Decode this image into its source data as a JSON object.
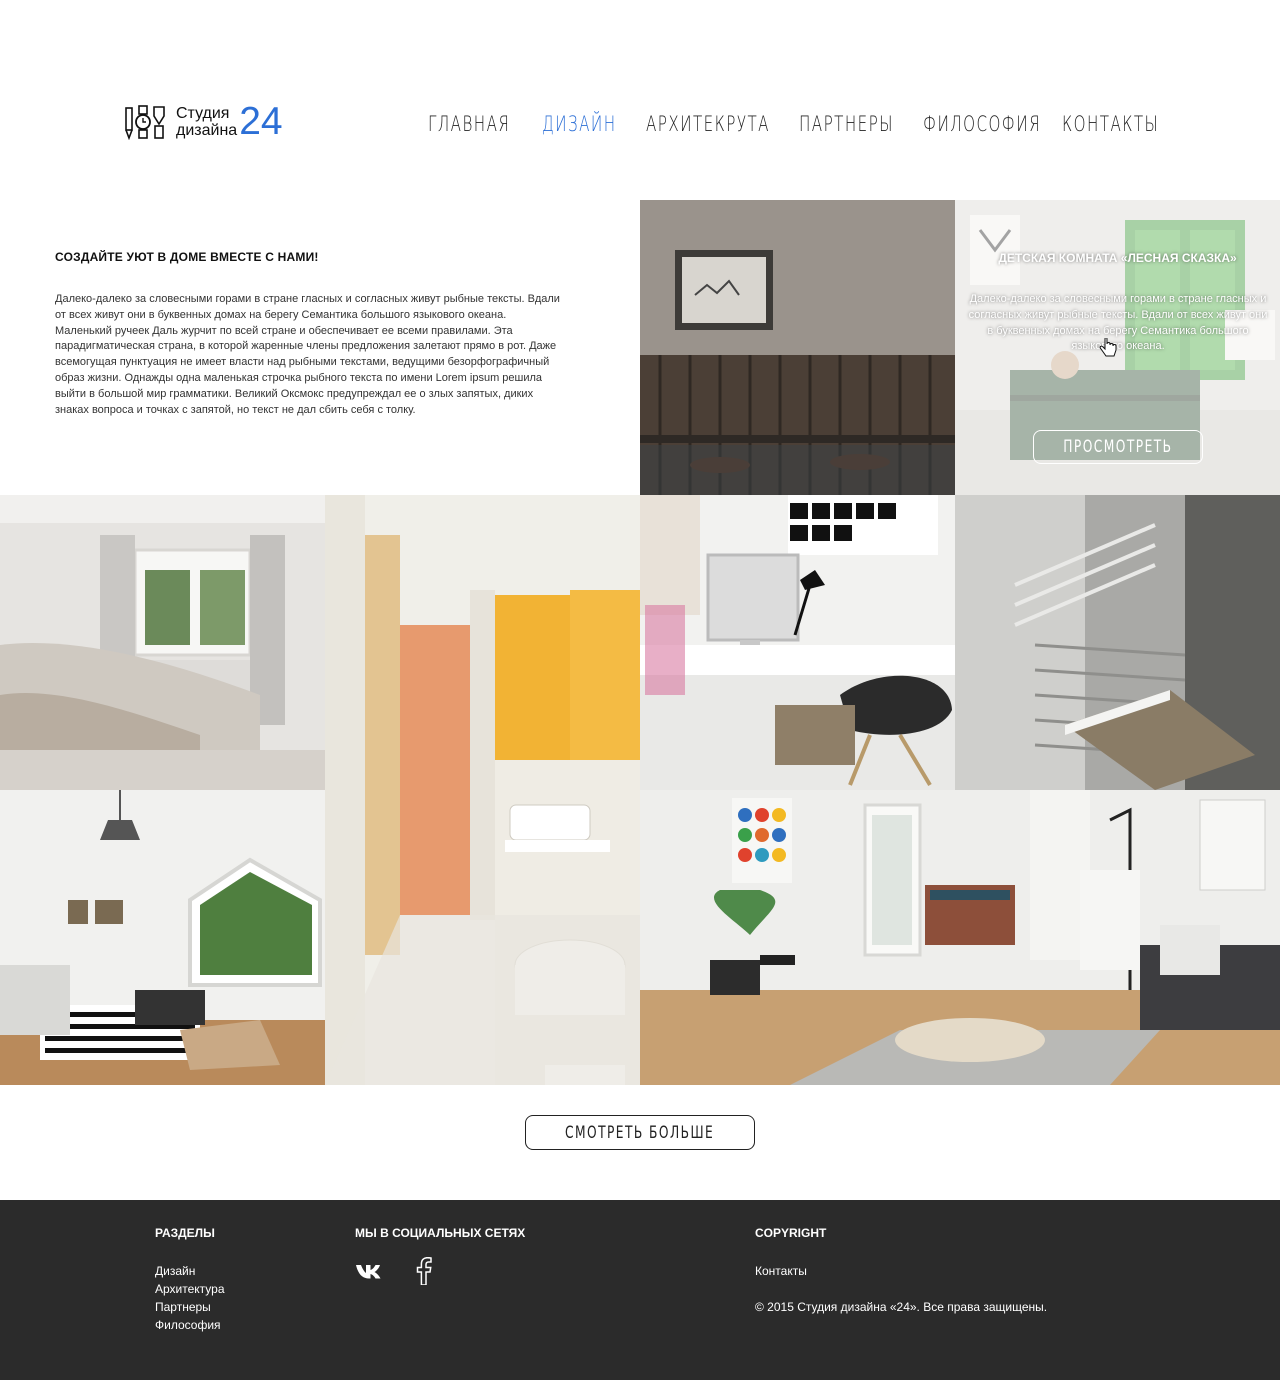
{
  "brand": {
    "line1": "Студия",
    "line2": "дизайна",
    "number": "24",
    "accent_color": "#2c6fd6"
  },
  "nav": {
    "items": [
      {
        "label": "Главная",
        "active": false
      },
      {
        "label": "Дизайн",
        "active": true
      },
      {
        "label": "Архитекрута",
        "active": false
      },
      {
        "label": "Партнеры",
        "active": false
      },
      {
        "label": "Философия",
        "active": false
      },
      {
        "label": "Контакты",
        "active": false
      }
    ]
  },
  "intro": {
    "title": "СОЗДАЙТЕ УЮТ В ДОМЕ ВМЕСТЕ С НАМИ!",
    "text": "Далеко-далеко за словесными горами в стране гласных и согласных живут рыбные тексты. Вдали от всех живут они в буквенных домах на берегу Семантика большого языкового океана. Маленький ручеек Даль журчит по всей стране и обеспечивает ее всеми правилами. Эта парадигматическая страна, в которой жаренные члены предложения залетают прямо в рот. Даже всемогущая пунктуация не имеет власти над рыбными текстами, ведущими безорфографичный образ жизни. Однажды одна маленькая строчка рыбного текста по имени Lorem ipsum решила выйти в большой мир грамматики. Великий Оксмокс предупреждал ее о злых запятых, диких знаках вопроса и точках с запятой, но текст не дал сбить себя с толку."
  },
  "featured": {
    "title": "ДЕТСКАЯ КОМНАТА «ЛЕСНАЯ СКАЗКА»",
    "text": "Далеко-далеко за словесными горами в стране гласных и согласных живут рыбные тексты. Вдали от всех живут они в буквенных домах на берегу Семантика большого языкового океана.",
    "button_label": "Просмотреть"
  },
  "more_button_label": "Смотреть больше",
  "footer": {
    "sections_title": "РАЗДЕЛЫ",
    "sections_links": [
      "Дизайн",
      "Архитектура",
      "Партнеры",
      "Философия"
    ],
    "social_title": "МЫ В СОЦИАЛЬНЫХ СЕТЯХ",
    "social_icons": [
      "vk-icon",
      "facebook-icon"
    ],
    "copyright_title": "COPYRIGHT",
    "contacts_link": "Контакты",
    "copyright_text": "© 2015 Студия дизайна «24». Все права защищены."
  }
}
